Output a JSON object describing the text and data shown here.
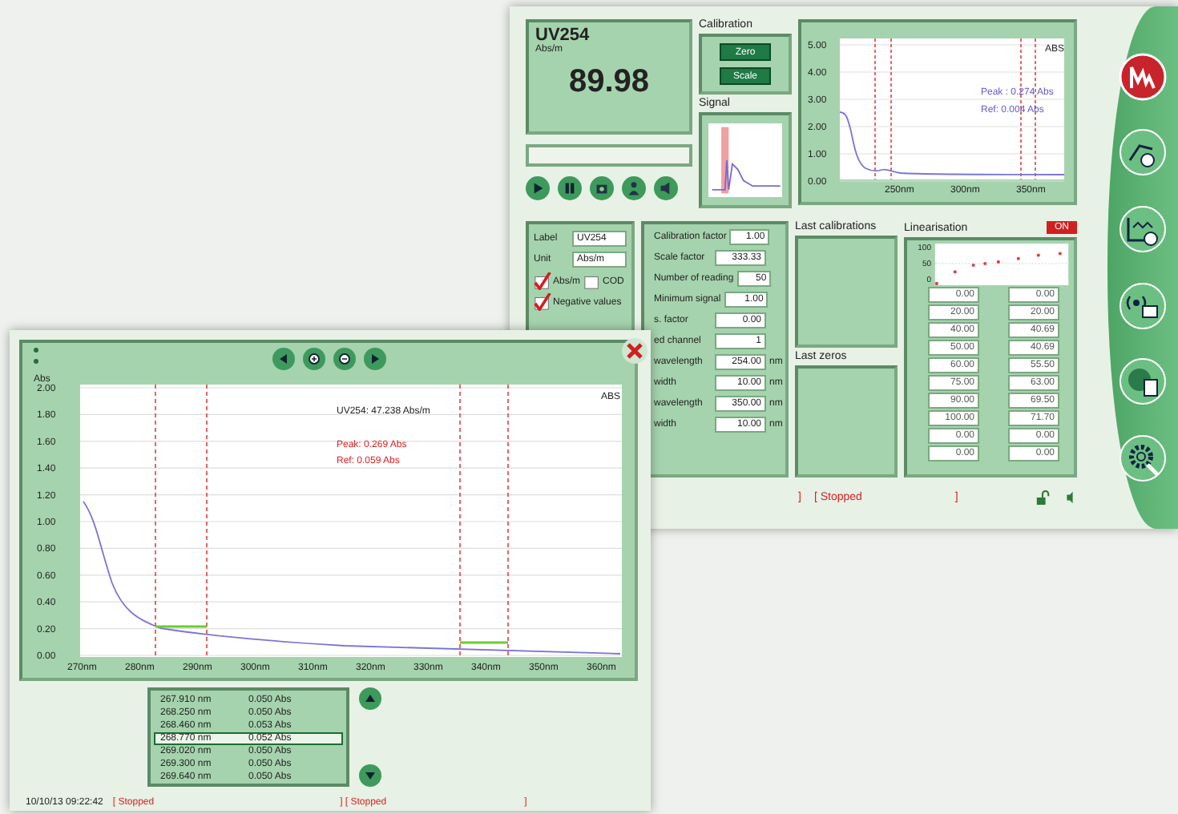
{
  "monitor_window": {
    "display": {
      "name": "UV254",
      "unit": "Abs/m",
      "value": "89.98"
    },
    "calibration": {
      "title": "Calibration",
      "buttons": [
        "Zero",
        "Scale"
      ]
    },
    "signal": {
      "title": "Signal"
    },
    "spectrum": {
      "yticks": [
        "5.00",
        "4.00",
        "3.00",
        "2.00",
        "1.00",
        "0.00"
      ],
      "xticks": [
        "250nm",
        "300nm",
        "350nm"
      ],
      "mode": "ABS",
      "peak": "Peak : 0.274 Abs",
      "ref": "Ref: 0.004 Abs"
    },
    "settings": {
      "fields": [
        {
          "label": "Label",
          "value": "UV254"
        },
        {
          "label": "Unit",
          "value": "Abs/m"
        }
      ],
      "checkboxes": [
        {
          "label": "Abs/m",
          "checked": true
        },
        {
          "label": "COD",
          "checked": false
        },
        {
          "label": "Negative values",
          "checked": true
        }
      ]
    },
    "parameters": [
      {
        "label": "Calibration factor",
        "value": "1.00"
      },
      {
        "label": "Scale factor",
        "value": "333.33"
      },
      {
        "label": "Number of reading",
        "value": "50"
      },
      {
        "label": "Minimum signal",
        "value": "1.00"
      },
      {
        "label": "s. factor",
        "value": "0.00"
      },
      {
        "label": "ed channel",
        "value": "1"
      },
      {
        "label": "wavelength",
        "value": "254.00",
        "unit": "nm"
      },
      {
        "label": "width",
        "value": "10.00",
        "unit": "nm"
      },
      {
        "label": "wavelength",
        "value": "350.00",
        "unit": "nm"
      },
      {
        "label": "width",
        "value": "10.00",
        "unit": "nm"
      }
    ],
    "last_calibrations": {
      "title": "Last calibrations"
    },
    "last_zeros": {
      "title": "Last zeros"
    },
    "linearisation": {
      "title": "Linearisation",
      "status": "ON",
      "on": true,
      "yticks": [
        "100",
        "50",
        "0"
      ],
      "rows": [
        {
          "input": "0.00",
          "output": "0.00"
        },
        {
          "input": "20.00",
          "output": "20.00"
        },
        {
          "input": "40.00",
          "output": "40.69"
        },
        {
          "input": "50.00",
          "output": "40.69"
        },
        {
          "input": "60.00",
          "output": "55.50"
        },
        {
          "input": "75.00",
          "output": "63.00"
        },
        {
          "input": "90.00",
          "output": "69.50"
        },
        {
          "input": "100.00",
          "output": "71.70"
        },
        {
          "input": "0.00",
          "output": "0.00"
        },
        {
          "input": "0.00",
          "output": "0.00"
        }
      ]
    },
    "status_bar": {
      "open": "]",
      "state": "[ Stopped",
      "close": "]"
    },
    "nav": [
      {
        "kind": "logo"
      },
      {
        "kind": "method"
      },
      {
        "kind": "schedule"
      },
      {
        "kind": "remote"
      },
      {
        "kind": "network"
      },
      {
        "kind": "settings"
      }
    ]
  },
  "scan_window": {
    "chart": {
      "ylabel": "Abs",
      "yticks": [
        "2.00",
        "1.80",
        "1.60",
        "1.40",
        "1.20",
        "1.00",
        "0.80",
        "0.60",
        "0.40",
        "0.20",
        "0.00"
      ],
      "xticks": [
        "270nm",
        "280nm",
        "290nm",
        "300nm",
        "310nm",
        "320nm",
        "330nm",
        "340nm",
        "350nm",
        "360nm"
      ],
      "mode": "ABS",
      "reading": "UV254: 47.238 Abs/m",
      "peak": "Peak: 0.269 Abs",
      "ref": "Ref: 0.059 Abs"
    },
    "points": [
      {
        "wavelength": "267.910 nm",
        "value": "0.050 Abs",
        "selected": false
      },
      {
        "wavelength": "268.250 nm",
        "value": "0.050 Abs",
        "selected": false
      },
      {
        "wavelength": "268.460 nm",
        "value": "0.053 Abs",
        "selected": false
      },
      {
        "wavelength": "268.770 nm",
        "value": "0.052 Abs",
        "selected": true
      },
      {
        "wavelength": "269.020 nm",
        "value": "0.050 Abs",
        "selected": false
      },
      {
        "wavelength": "269.300 nm",
        "value": "0.050 Abs",
        "selected": false
      },
      {
        "wavelength": "269.640 nm",
        "value": "0.050 Abs",
        "selected": false
      }
    ],
    "status_bar": {
      "datetime": "10/10/13 09:22:42",
      "state_1": "[ Stopped",
      "state_2": "] [ Stopped",
      "close": "]"
    }
  }
}
